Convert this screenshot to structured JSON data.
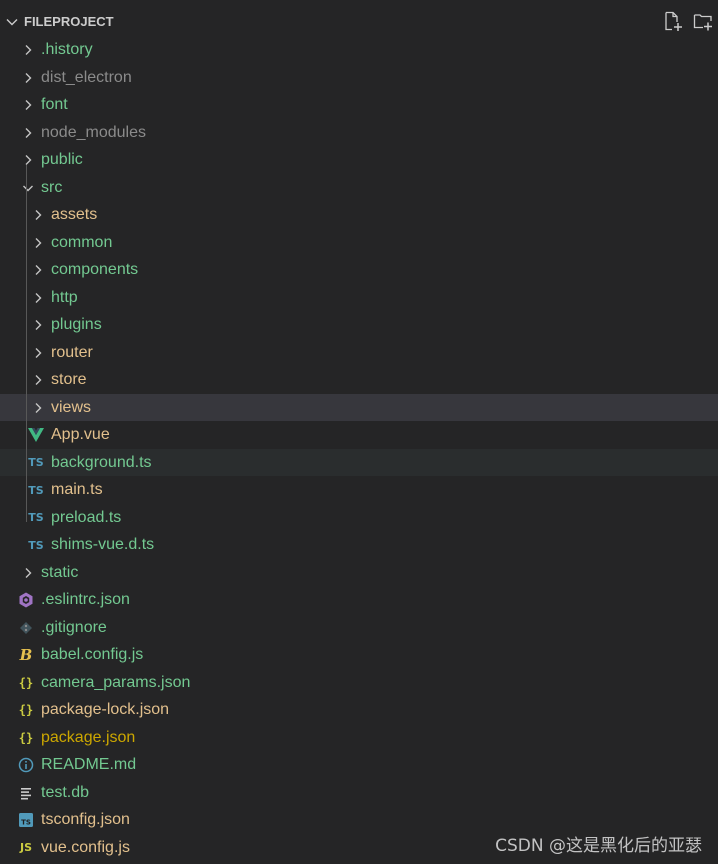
{
  "explorer": {
    "title": "FILEPROJECT",
    "actions": [
      "new-file-icon",
      "new-folder-icon"
    ]
  },
  "tree": [
    {
      "label": ".history",
      "type": "folder",
      "depth": 0,
      "expanded": false,
      "color": "#73c991"
    },
    {
      "label": "dist_electron",
      "type": "folder",
      "depth": 0,
      "expanded": false,
      "color": "#8b8b8b"
    },
    {
      "label": "font",
      "type": "folder",
      "depth": 0,
      "expanded": false,
      "color": "#73c991"
    },
    {
      "label": "node_modules",
      "type": "folder",
      "depth": 0,
      "expanded": false,
      "color": "#8b8b8b"
    },
    {
      "label": "public",
      "type": "folder",
      "depth": 0,
      "expanded": false,
      "color": "#73c991"
    },
    {
      "label": "src",
      "type": "folder",
      "depth": 0,
      "expanded": true,
      "color": "#73c991"
    },
    {
      "label": "assets",
      "type": "folder",
      "depth": 1,
      "expanded": false,
      "color": "#e2c08d"
    },
    {
      "label": "common",
      "type": "folder",
      "depth": 1,
      "expanded": false,
      "color": "#73c991"
    },
    {
      "label": "components",
      "type": "folder",
      "depth": 1,
      "expanded": false,
      "color": "#73c991"
    },
    {
      "label": "http",
      "type": "folder",
      "depth": 1,
      "expanded": false,
      "color": "#73c991"
    },
    {
      "label": "plugins",
      "type": "folder",
      "depth": 1,
      "expanded": false,
      "color": "#73c991"
    },
    {
      "label": "router",
      "type": "folder",
      "depth": 1,
      "expanded": false,
      "color": "#e2c08d"
    },
    {
      "label": "store",
      "type": "folder",
      "depth": 1,
      "expanded": false,
      "color": "#e2c08d"
    },
    {
      "label": "views",
      "type": "folder",
      "depth": 1,
      "expanded": false,
      "color": "#e2c08d",
      "highlight": "views"
    },
    {
      "label": "App.vue",
      "type": "file",
      "icon": "vue-icon",
      "depth": 1,
      "color": "#e2c08d"
    },
    {
      "label": "background.ts",
      "type": "file",
      "icon": "typescript-icon",
      "depth": 1,
      "color": "#73c991",
      "highlight": "bg"
    },
    {
      "label": "main.ts",
      "type": "file",
      "icon": "typescript-icon",
      "depth": 1,
      "color": "#e2c08d"
    },
    {
      "label": "preload.ts",
      "type": "file",
      "icon": "typescript-icon",
      "depth": 1,
      "color": "#73c991"
    },
    {
      "label": "shims-vue.d.ts",
      "type": "file",
      "icon": "typescript-icon",
      "depth": 1,
      "color": "#73c991"
    },
    {
      "label": "static",
      "type": "folder",
      "depth": 0,
      "expanded": false,
      "color": "#73c991"
    },
    {
      "label": ".eslintrc.json",
      "type": "file",
      "icon": "eslint-icon",
      "depth": 0,
      "color": "#73c991"
    },
    {
      "label": ".gitignore",
      "type": "file",
      "icon": "git-icon",
      "depth": 0,
      "color": "#73c991"
    },
    {
      "label": "babel.config.js",
      "type": "file",
      "icon": "babel-icon",
      "depth": 0,
      "color": "#73c991"
    },
    {
      "label": "camera_params.json",
      "type": "file",
      "icon": "json-icon",
      "depth": 0,
      "color": "#73c991"
    },
    {
      "label": "package-lock.json",
      "type": "file",
      "icon": "json-icon",
      "depth": 0,
      "color": "#e2c08d"
    },
    {
      "label": "package.json",
      "type": "file",
      "icon": "json-icon",
      "depth": 0,
      "color": "#cca700"
    },
    {
      "label": "README.md",
      "type": "file",
      "icon": "info-icon",
      "depth": 0,
      "color": "#73c991"
    },
    {
      "label": "test.db",
      "type": "file",
      "icon": "lines-icon",
      "depth": 0,
      "color": "#73c991"
    },
    {
      "label": "tsconfig.json",
      "type": "file",
      "icon": "tsconfig-icon",
      "depth": 0,
      "color": "#e2c08d"
    },
    {
      "label": "vue.config.js",
      "type": "file",
      "icon": "javascript-icon",
      "depth": 0,
      "color": "#e2c08d"
    }
  ],
  "watermark": "CSDN @这是黑化后的亚瑟"
}
